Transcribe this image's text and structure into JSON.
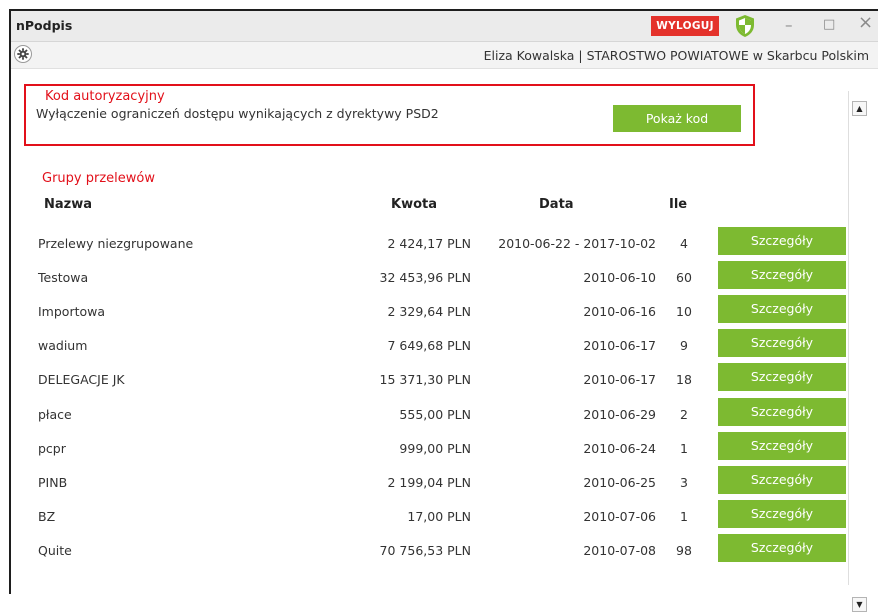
{
  "window": {
    "title": "nPodpis",
    "logout_label": "WYLOGUJ",
    "minimize": "–",
    "maximize": "□",
    "close": "×"
  },
  "toolbar": {
    "settings_icon": "gear-icon",
    "user_info": "Eliza Kowalska  |  STAROSTWO POWIATOWE w Skarbcu Polskim"
  },
  "auth": {
    "title": "Kod autoryzacyjny",
    "description": "Wyłączenie ograniczeń dostępu wynikających z dyrektywy PSD2",
    "button_label": "Pokaż kod"
  },
  "groups": {
    "title": "Grupy przelewów",
    "headers": {
      "name": "Nazwa",
      "amount": "Kwota",
      "date": "Data",
      "count": "Ile"
    },
    "rows": [
      {
        "name": "Przelewy niezgrupowane",
        "amount": "2 424,17 PLN",
        "date": "2010-06-22 - 2017-10-02",
        "count": "4",
        "action": "Szczegóły"
      },
      {
        "name": "Testowa",
        "amount": "32 453,96 PLN",
        "date": "2010-06-10",
        "count": "60",
        "action": "Szczegóły"
      },
      {
        "name": "Importowa",
        "amount": "2 329,64 PLN",
        "date": "2010-06-16",
        "count": "10",
        "action": "Szczegóły"
      },
      {
        "name": "wadium",
        "amount": "7 649,68 PLN",
        "date": "2010-06-17",
        "count": "9",
        "action": "Szczegóły"
      },
      {
        "name": "DELEGACJE JK",
        "amount": "15 371,30 PLN",
        "date": "2010-06-17",
        "count": "18",
        "action": "Szczegóły"
      },
      {
        "name": "płace",
        "amount": "555,00 PLN",
        "date": "2010-06-29",
        "count": "2",
        "action": "Szczegóły"
      },
      {
        "name": "pcpr",
        "amount": "999,00 PLN",
        "date": "2010-06-24",
        "count": "1",
        "action": "Szczegóły"
      },
      {
        "name": "PINB",
        "amount": "2 199,04 PLN",
        "date": "2010-06-25",
        "count": "3",
        "action": "Szczegóły"
      },
      {
        "name": "BZ",
        "amount": "17,00 PLN",
        "date": "2010-07-06",
        "count": "1",
        "action": "Szczegóły"
      },
      {
        "name": "Quite",
        "amount": "70 756,53 PLN",
        "date": "2010-07-08",
        "count": "98",
        "action": "Szczegóły"
      }
    ]
  },
  "colors": {
    "accent_green": "#7dba31",
    "alert_red": "#e2101a",
    "logout_red": "#e4322b"
  }
}
